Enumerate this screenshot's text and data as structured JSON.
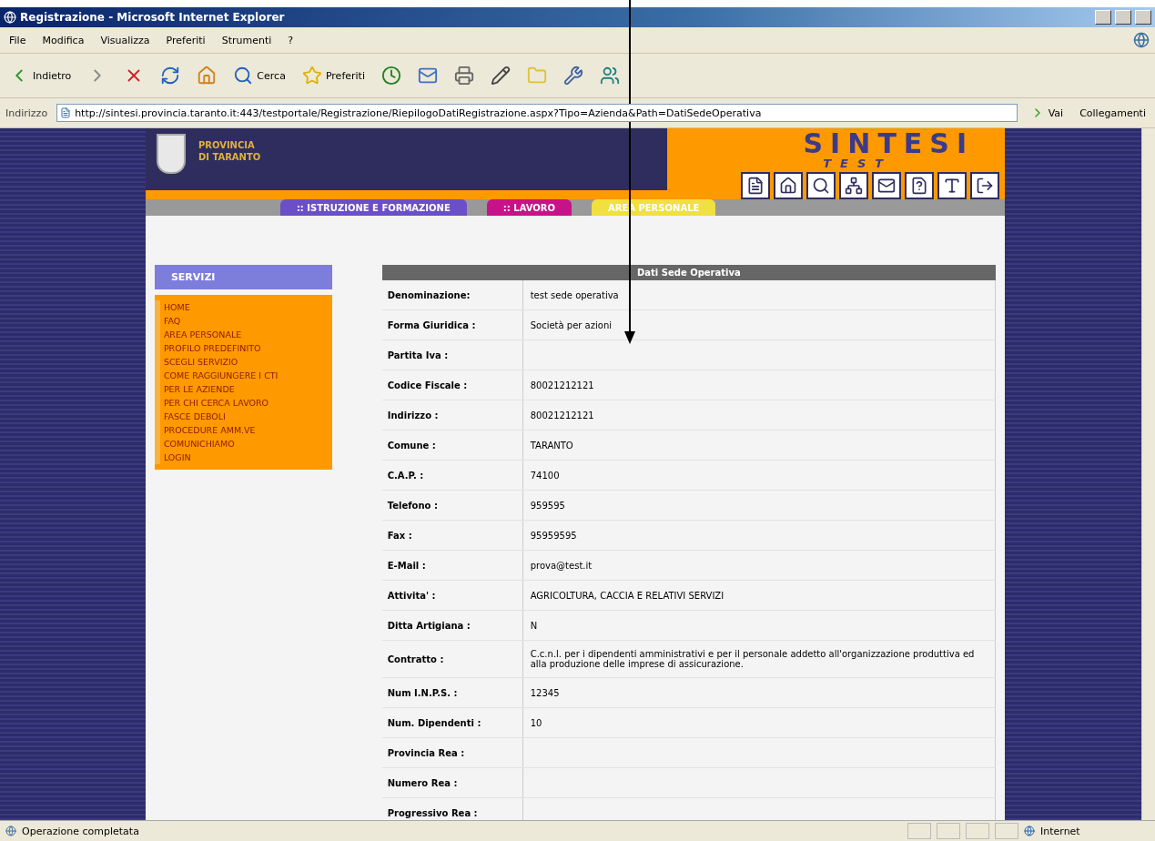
{
  "window": {
    "title": "Registrazione - Microsoft Internet Explorer"
  },
  "menu": [
    "File",
    "Modifica",
    "Visualizza",
    "Preferiti",
    "Strumenti",
    "?"
  ],
  "toolbar": [
    {
      "kind": "back",
      "label": "Indietro"
    },
    {
      "kind": "forward"
    },
    {
      "kind": "stop"
    },
    {
      "kind": "refresh"
    },
    {
      "kind": "home"
    },
    {
      "kind": "search",
      "label": "Cerca"
    },
    {
      "kind": "favorites",
      "label": "Preferiti"
    },
    {
      "kind": "history"
    },
    {
      "kind": "mail"
    },
    {
      "kind": "print"
    },
    {
      "kind": "edit"
    },
    {
      "kind": "folder"
    },
    {
      "kind": "tools"
    },
    {
      "kind": "messenger"
    }
  ],
  "address": {
    "label": "Indirizzo",
    "value": "http://sintesi.provincia.taranto.it:443/testportale/Registrazione/RiepilogoDatiRegistrazione.aspx?Tipo=Azienda&Path=DatiSedeOperativa",
    "go": "Vai",
    "links": "Collegamenti"
  },
  "header": {
    "province_line1": "PROVINCIA",
    "province_line2": "DI TARANTO",
    "logo": "SINTESI",
    "logo_sub": "TEST"
  },
  "header_icons": [
    {
      "kind": "document"
    },
    {
      "kind": "home"
    },
    {
      "kind": "search"
    },
    {
      "kind": "network"
    },
    {
      "kind": "mail"
    },
    {
      "kind": "help"
    },
    {
      "kind": "font"
    },
    {
      "kind": "exit"
    }
  ],
  "nav_tabs": [
    {
      "label": ":: ISTRUZIONE E FORMAZIONE",
      "color": "#6a4fc8"
    },
    {
      "label": ":: LAVORO",
      "color": "#c8128a"
    },
    {
      "label": "AREA PERSONALE",
      "color": "#f0e040"
    }
  ],
  "sidebar": {
    "title": "SERVIZI",
    "items": [
      "HOME",
      "FAQ",
      "AREA PERSONALE",
      "PROFILO PREDEFINITO",
      "SCEGLI SERVIZIO",
      "COME RAGGIUNGERE I CTI",
      "PER LE AZIENDE",
      "PER CHI CERCA LAVORO",
      "FASCE DEBOLI",
      "PROCEDURE AMM.VE",
      "COMUNICHIAMO",
      "LOGIN"
    ]
  },
  "table": {
    "title": "Dati Sede Operativa",
    "rows": [
      {
        "label": "Denominazione:",
        "value": "test sede operativa"
      },
      {
        "label": "Forma Giuridica :",
        "value": "Società per azioni"
      },
      {
        "label": "Partita Iva :"
      },
      {
        "label": "Codice Fiscale :",
        "value": "80021212121"
      },
      {
        "label": "Indirizzo :",
        "value": "80021212121"
      },
      {
        "label": "Comune :",
        "value": "TARANTO"
      },
      {
        "label": "C.A.P. :",
        "value": "74100"
      },
      {
        "label": "Telefono :",
        "value": "959595"
      },
      {
        "label": "Fax :",
        "value": "95959595"
      },
      {
        "label": "E-Mail :",
        "value": "prova@test.it"
      },
      {
        "label": "Attivita' :",
        "value": "AGRICOLTURA, CACCIA E RELATIVI SERVIZI"
      },
      {
        "label": "Ditta Artigiana :",
        "value": "N"
      },
      {
        "label": "Contratto :",
        "value": "C.c.n.l. per i dipendenti amministrativi e per il personale addetto all'organizzazione produttiva ed alla produzione delle imprese di assicurazione."
      },
      {
        "label": "Num I.N.P.S. :",
        "value": "12345"
      },
      {
        "label": "Num. Dipendenti :",
        "value": "10"
      },
      {
        "label": "Provincia Rea :"
      },
      {
        "label": "Numero Rea :"
      },
      {
        "label": "Progressivo Rea :"
      }
    ]
  },
  "status_bar": {
    "text": "Operazione completata",
    "zone": "Internet"
  }
}
